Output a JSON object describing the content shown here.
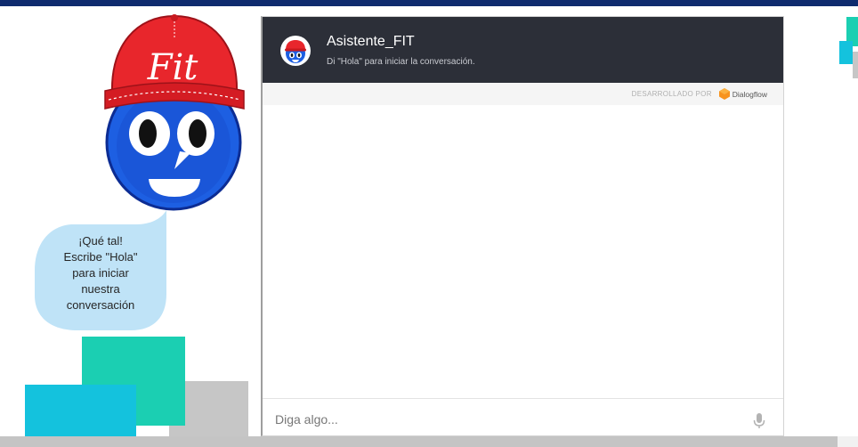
{
  "mascot": {
    "cap_text": "Fit"
  },
  "bubble": {
    "lines": [
      "¡Qué tal!",
      "Escribe \"Hola\"",
      "para iniciar",
      "nuestra",
      "conversación"
    ]
  },
  "chat": {
    "title": "Asistente_FIT",
    "subtitle": "Di \"Hola\" para iniciar la conversación.",
    "powered_by_label": "DESARROLLADO POR",
    "powered_by_brand": "Dialogflow",
    "input_placeholder": "Diga algo..."
  },
  "icons": {
    "mascot": "fit-mascot-illustration",
    "avatar": "bot-avatar-icon",
    "brand": "dialogflow-icon",
    "mic": "microphone-icon"
  },
  "colors": {
    "top_bar": "#0f2b6e",
    "chat_header": "#2c2f38",
    "bubble": "#bfe3f7",
    "mascot_blue": "#1d5fe2",
    "cap_red": "#e8262c",
    "accent_green": "#1bcfb2",
    "accent_cyan": "#14c2dd",
    "accent_gray": "#c6c6c6",
    "dialogflow_orange": "#f7931e"
  }
}
